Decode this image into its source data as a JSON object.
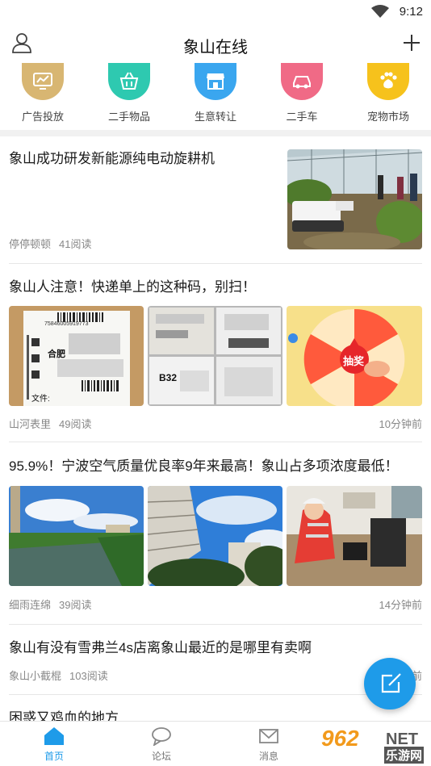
{
  "status_bar": {
    "time": "9:12"
  },
  "header": {
    "title": "象山在线"
  },
  "categories": [
    {
      "label": "广告投放",
      "icon": "monitor-icon",
      "color": "#d8b672"
    },
    {
      "label": "二手物品",
      "icon": "basket-icon",
      "color": "#2ec9b0"
    },
    {
      "label": "生意转让",
      "icon": "shop-icon",
      "color": "#3aa6ef"
    },
    {
      "label": "二手车",
      "icon": "car-icon",
      "color": "#f06a86"
    },
    {
      "label": "宠物市场",
      "icon": "paw-icon",
      "color": "#f6c21c"
    }
  ],
  "feed": [
    {
      "title": "象山成功研发新能源纯电动旋耕机",
      "author": "停停顿顿",
      "reads": "41阅读",
      "time": ""
    },
    {
      "title": "象山人注意！快递单上的这种码，别扫！",
      "author": "山河表里",
      "reads": "49阅读",
      "time": "10分钟前"
    },
    {
      "title": "95.9%！宁波空气质量优良率9年来最高！象山占多项浓度最低！",
      "author": "细雨连绵",
      "reads": "39阅读",
      "time": "14分钟前"
    },
    {
      "title": "象山有没有雪弗兰4s店离象山最近的是哪里有卖啊",
      "author": "象山小截棍",
      "reads": "103阅读",
      "time": "前"
    },
    {
      "title": "困惑又鸡血的地方",
      "author": "",
      "reads": "",
      "time": ""
    }
  ],
  "image_text": {
    "label_city": "合肥",
    "label_file": "文件:",
    "label_b32": "B32",
    "wheel_center": "抽奖",
    "barcode_number": "75846005919773"
  },
  "tabs": [
    {
      "label": "首页",
      "icon": "home-icon",
      "active": true
    },
    {
      "label": "论坛",
      "icon": "chat-bubble-icon",
      "active": false
    },
    {
      "label": "消息",
      "icon": "mail-icon",
      "active": false
    }
  ],
  "watermark": {
    "number": "962",
    "suffix": "NET",
    "cn": "乐游网"
  },
  "colors": {
    "accent": "#1e9be9",
    "divider": "#f1f1f1"
  }
}
